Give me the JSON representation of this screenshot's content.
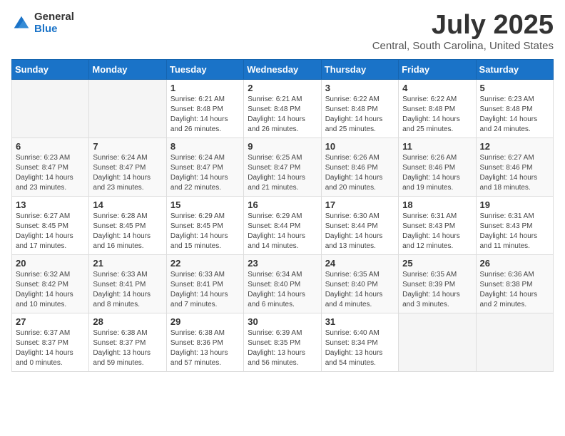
{
  "logo": {
    "general": "General",
    "blue": "Blue"
  },
  "title": {
    "month": "July 2025",
    "location": "Central, South Carolina, United States"
  },
  "headers": [
    "Sunday",
    "Monday",
    "Tuesday",
    "Wednesday",
    "Thursday",
    "Friday",
    "Saturday"
  ],
  "weeks": [
    [
      {
        "day": "",
        "content": ""
      },
      {
        "day": "",
        "content": ""
      },
      {
        "day": "1",
        "sunrise": "Sunrise: 6:21 AM",
        "sunset": "Sunset: 8:48 PM",
        "daylight": "Daylight: 14 hours and 26 minutes."
      },
      {
        "day": "2",
        "sunrise": "Sunrise: 6:21 AM",
        "sunset": "Sunset: 8:48 PM",
        "daylight": "Daylight: 14 hours and 26 minutes."
      },
      {
        "day": "3",
        "sunrise": "Sunrise: 6:22 AM",
        "sunset": "Sunset: 8:48 PM",
        "daylight": "Daylight: 14 hours and 25 minutes."
      },
      {
        "day": "4",
        "sunrise": "Sunrise: 6:22 AM",
        "sunset": "Sunset: 8:48 PM",
        "daylight": "Daylight: 14 hours and 25 minutes."
      },
      {
        "day": "5",
        "sunrise": "Sunrise: 6:23 AM",
        "sunset": "Sunset: 8:48 PM",
        "daylight": "Daylight: 14 hours and 24 minutes."
      }
    ],
    [
      {
        "day": "6",
        "sunrise": "Sunrise: 6:23 AM",
        "sunset": "Sunset: 8:47 PM",
        "daylight": "Daylight: 14 hours and 23 minutes."
      },
      {
        "day": "7",
        "sunrise": "Sunrise: 6:24 AM",
        "sunset": "Sunset: 8:47 PM",
        "daylight": "Daylight: 14 hours and 23 minutes."
      },
      {
        "day": "8",
        "sunrise": "Sunrise: 6:24 AM",
        "sunset": "Sunset: 8:47 PM",
        "daylight": "Daylight: 14 hours and 22 minutes."
      },
      {
        "day": "9",
        "sunrise": "Sunrise: 6:25 AM",
        "sunset": "Sunset: 8:47 PM",
        "daylight": "Daylight: 14 hours and 21 minutes."
      },
      {
        "day": "10",
        "sunrise": "Sunrise: 6:26 AM",
        "sunset": "Sunset: 8:46 PM",
        "daylight": "Daylight: 14 hours and 20 minutes."
      },
      {
        "day": "11",
        "sunrise": "Sunrise: 6:26 AM",
        "sunset": "Sunset: 8:46 PM",
        "daylight": "Daylight: 14 hours and 19 minutes."
      },
      {
        "day": "12",
        "sunrise": "Sunrise: 6:27 AM",
        "sunset": "Sunset: 8:46 PM",
        "daylight": "Daylight: 14 hours and 18 minutes."
      }
    ],
    [
      {
        "day": "13",
        "sunrise": "Sunrise: 6:27 AM",
        "sunset": "Sunset: 8:45 PM",
        "daylight": "Daylight: 14 hours and 17 minutes."
      },
      {
        "day": "14",
        "sunrise": "Sunrise: 6:28 AM",
        "sunset": "Sunset: 8:45 PM",
        "daylight": "Daylight: 14 hours and 16 minutes."
      },
      {
        "day": "15",
        "sunrise": "Sunrise: 6:29 AM",
        "sunset": "Sunset: 8:45 PM",
        "daylight": "Daylight: 14 hours and 15 minutes."
      },
      {
        "day": "16",
        "sunrise": "Sunrise: 6:29 AM",
        "sunset": "Sunset: 8:44 PM",
        "daylight": "Daylight: 14 hours and 14 minutes."
      },
      {
        "day": "17",
        "sunrise": "Sunrise: 6:30 AM",
        "sunset": "Sunset: 8:44 PM",
        "daylight": "Daylight: 14 hours and 13 minutes."
      },
      {
        "day": "18",
        "sunrise": "Sunrise: 6:31 AM",
        "sunset": "Sunset: 8:43 PM",
        "daylight": "Daylight: 14 hours and 12 minutes."
      },
      {
        "day": "19",
        "sunrise": "Sunrise: 6:31 AM",
        "sunset": "Sunset: 8:43 PM",
        "daylight": "Daylight: 14 hours and 11 minutes."
      }
    ],
    [
      {
        "day": "20",
        "sunrise": "Sunrise: 6:32 AM",
        "sunset": "Sunset: 8:42 PM",
        "daylight": "Daylight: 14 hours and 10 minutes."
      },
      {
        "day": "21",
        "sunrise": "Sunrise: 6:33 AM",
        "sunset": "Sunset: 8:41 PM",
        "daylight": "Daylight: 14 hours and 8 minutes."
      },
      {
        "day": "22",
        "sunrise": "Sunrise: 6:33 AM",
        "sunset": "Sunset: 8:41 PM",
        "daylight": "Daylight: 14 hours and 7 minutes."
      },
      {
        "day": "23",
        "sunrise": "Sunrise: 6:34 AM",
        "sunset": "Sunset: 8:40 PM",
        "daylight": "Daylight: 14 hours and 6 minutes."
      },
      {
        "day": "24",
        "sunrise": "Sunrise: 6:35 AM",
        "sunset": "Sunset: 8:40 PM",
        "daylight": "Daylight: 14 hours and 4 minutes."
      },
      {
        "day": "25",
        "sunrise": "Sunrise: 6:35 AM",
        "sunset": "Sunset: 8:39 PM",
        "daylight": "Daylight: 14 hours and 3 minutes."
      },
      {
        "day": "26",
        "sunrise": "Sunrise: 6:36 AM",
        "sunset": "Sunset: 8:38 PM",
        "daylight": "Daylight: 14 hours and 2 minutes."
      }
    ],
    [
      {
        "day": "27",
        "sunrise": "Sunrise: 6:37 AM",
        "sunset": "Sunset: 8:37 PM",
        "daylight": "Daylight: 14 hours and 0 minutes."
      },
      {
        "day": "28",
        "sunrise": "Sunrise: 6:38 AM",
        "sunset": "Sunset: 8:37 PM",
        "daylight": "Daylight: 13 hours and 59 minutes."
      },
      {
        "day": "29",
        "sunrise": "Sunrise: 6:38 AM",
        "sunset": "Sunset: 8:36 PM",
        "daylight": "Daylight: 13 hours and 57 minutes."
      },
      {
        "day": "30",
        "sunrise": "Sunrise: 6:39 AM",
        "sunset": "Sunset: 8:35 PM",
        "daylight": "Daylight: 13 hours and 56 minutes."
      },
      {
        "day": "31",
        "sunrise": "Sunrise: 6:40 AM",
        "sunset": "Sunset: 8:34 PM",
        "daylight": "Daylight: 13 hours and 54 minutes."
      },
      {
        "day": "",
        "content": ""
      },
      {
        "day": "",
        "content": ""
      }
    ]
  ]
}
